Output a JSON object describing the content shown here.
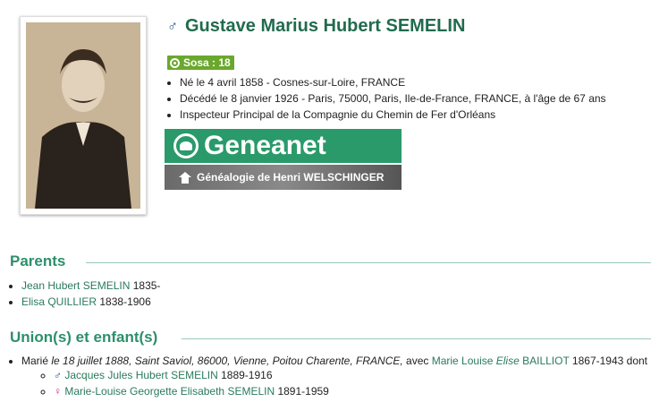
{
  "person": {
    "name": "Gustave Marius Hubert SEMELIN",
    "gender_symbol": "♂",
    "sosa_label": "Sosa : 18",
    "facts": [
      "Né le 4 avril 1858 - Cosnes-sur-Loire, FRANCE",
      "Décédé le 8 janvier 1926 - Paris, 75000, Paris, Ile-de-France, FRANCE, à l'âge de 67 ans",
      "Inspecteur Principal de la Compagnie du Chemin de Fer d'Orléans"
    ]
  },
  "geneanet": {
    "logo_text": "Geneanet",
    "tree_label": "Généalogie de Henri WELSCHINGER"
  },
  "parents": {
    "heading": "Parents",
    "items": [
      {
        "name": "Jean Hubert SEMELIN",
        "dates": "1835-"
      },
      {
        "name": "Elisa QUILLIER",
        "dates": "1838-1906"
      }
    ]
  },
  "unions": {
    "heading": "Union(s) et enfant(s)",
    "marriage": {
      "prefix": "Marié ",
      "date_place": "le 18 juillet 1888, Saint Saviol, 86000, Vienne, Poitou Charente, FRANCE,",
      "with": " avec ",
      "spouse_first": "Marie Louise ",
      "spouse_middle": "Elise",
      "spouse_last": " BAILLIOT",
      "spouse_dates": " 1867-1943 dont"
    },
    "children": [
      {
        "symbol": "♂",
        "name": "Jacques Jules Hubert SEMELIN",
        "dates": " 1889-1916"
      },
      {
        "symbol": "♀",
        "name": "Marie-Louise Georgette Elisabeth SEMELIN",
        "dates": " 1891-1959"
      }
    ]
  },
  "colors": {
    "title_green": "#216b4e",
    "section_green": "#2d8f6b",
    "sosa_badge": "#6aa82d",
    "geneanet_green": "#2a9a6a",
    "male_blue": "#1f4d8f",
    "female_pink": "#c8378a"
  }
}
